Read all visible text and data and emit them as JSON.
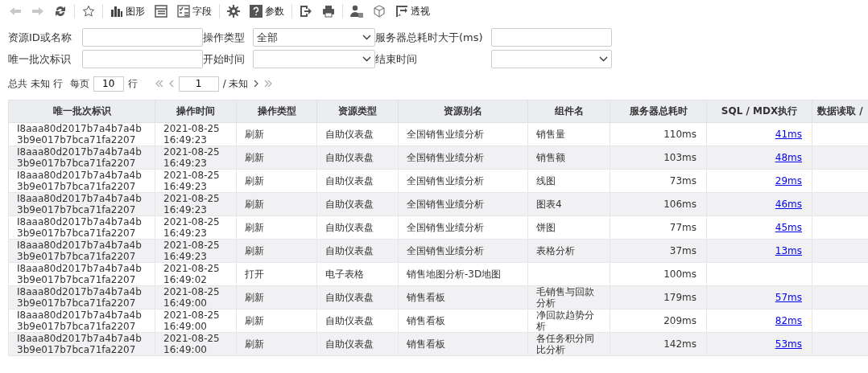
{
  "toolbar": [
    {
      "kind": "back"
    },
    {
      "kind": "forward"
    },
    {
      "kind": "refresh"
    },
    {
      "kind": "sep"
    },
    {
      "kind": "star"
    },
    {
      "kind": "sep"
    },
    {
      "kind": "chart",
      "label": "图形"
    },
    {
      "kind": "layout"
    },
    {
      "kind": "fields",
      "label": "字段"
    },
    {
      "kind": "sep"
    },
    {
      "kind": "gear"
    },
    {
      "kind": "help",
      "label": "参数"
    },
    {
      "kind": "sep"
    },
    {
      "kind": "export"
    },
    {
      "kind": "print"
    },
    {
      "kind": "sep"
    },
    {
      "kind": "user"
    },
    {
      "kind": "cube"
    },
    {
      "kind": "pivot",
      "label": "透视"
    }
  ],
  "filters": [
    {
      "label": "资源ID或名称",
      "kind": "text"
    },
    {
      "label": "操作类型",
      "kind": "select",
      "value": "全部"
    },
    {
      "label": "服务器总耗时大于(ms)",
      "kind": "text"
    },
    {
      "label": "唯一批次标识",
      "kind": "text"
    },
    {
      "label": "开始时间",
      "kind": "select"
    },
    {
      "label": "结束时间",
      "kind": "select"
    }
  ],
  "pager": {
    "total_prefix": "总共",
    "total": "未知",
    "total_suffix": "行",
    "per_page_label": "每页",
    "per_page": "10",
    "per_page_suffix": "行",
    "page": "1",
    "pages": "/ 未知"
  },
  "table": {
    "columns": [
      "唯一批次标识",
      "操作时间",
      "操作类型",
      "资源类型",
      "资源别名",
      "组件名",
      "服务器总耗时",
      "SQL / MDX执行",
      "数据读取 /"
    ],
    "rows": [
      {
        "id": "I8aaa80d2017b7a4b7a4b3b9e017b7bca71fa2207",
        "time": "2021-08-25 16:49:23",
        "op": "刷新",
        "type": "自助仪表盘",
        "alias": "全国销售业绩分析",
        "component": "销售量",
        "total": "110ms",
        "sql": "41ms"
      },
      {
        "id": "I8aaa80d2017b7a4b7a4b3b9e017b7bca71fa2207",
        "time": "2021-08-25 16:49:23",
        "op": "刷新",
        "type": "自助仪表盘",
        "alias": "全国销售业绩分析",
        "component": "销售额",
        "total": "103ms",
        "sql": "48ms"
      },
      {
        "id": "I8aaa80d2017b7a4b7a4b3b9e017b7bca71fa2207",
        "time": "2021-08-25 16:49:23",
        "op": "刷新",
        "type": "自助仪表盘",
        "alias": "全国销售业绩分析",
        "component": "线图",
        "total": "73ms",
        "sql": "29ms"
      },
      {
        "id": "I8aaa80d2017b7a4b7a4b3b9e017b7bca71fa2207",
        "time": "2021-08-25 16:49:23",
        "op": "刷新",
        "type": "自助仪表盘",
        "alias": "全国销售业绩分析",
        "component": "图表4",
        "total": "106ms",
        "sql": "46ms"
      },
      {
        "id": "I8aaa80d2017b7a4b7a4b3b9e017b7bca71fa2207",
        "time": "2021-08-25 16:49:23",
        "op": "刷新",
        "type": "自助仪表盘",
        "alias": "全国销售业绩分析",
        "component": "饼图",
        "total": "77ms",
        "sql": "45ms"
      },
      {
        "id": "I8aaa80d2017b7a4b7a4b3b9e017b7bca71fa2207",
        "time": "2021-08-25 16:49:23",
        "op": "刷新",
        "type": "自助仪表盘",
        "alias": "全国销售业绩分析",
        "component": "表格分析",
        "total": "37ms",
        "sql": "13ms"
      },
      {
        "id": "I8aaa80d2017b7a4b7a4b3b9e017b7bca71fa2207",
        "time": "2021-08-25 16:49:02",
        "op": "打开",
        "type": "电子表格",
        "alias": "销售地图分析-3D地图",
        "total": "100ms"
      },
      {
        "id": "I8aaa80d2017b7a4b7a4b3b9e017b7bca71fa2207",
        "time": "2021-08-25 16:49:00",
        "op": "刷新",
        "type": "自助仪表盘",
        "alias": "销售看板",
        "component": "毛销售与回款分析",
        "total": "179ms",
        "sql": "57ms"
      },
      {
        "id": "I8aaa80d2017b7a4b7a4b3b9e017b7bca71fa2207",
        "time": "2021-08-25 16:49:00",
        "op": "刷新",
        "type": "自助仪表盘",
        "alias": "销售看板",
        "component": "净回款趋势分析",
        "total": "209ms",
        "sql": "82ms"
      },
      {
        "id": "I8aaa80d2017b7a4b7a4b3b9e017b7bca71fa2207",
        "time": "2021-08-25 16:49:00",
        "op": "刷新",
        "type": "自助仪表盘",
        "alias": "销售看板",
        "component": "各任务积分同比分析",
        "total": "142ms",
        "sql": "53ms"
      }
    ]
  }
}
